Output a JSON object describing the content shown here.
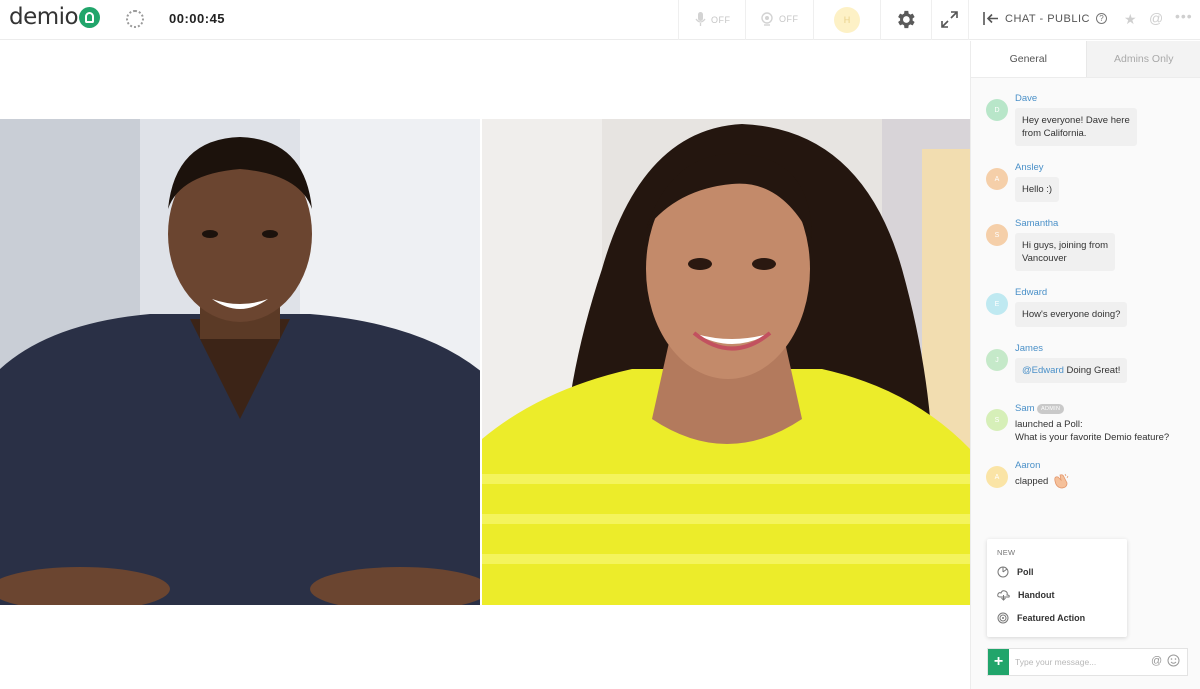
{
  "app": {
    "logo_text": "demio",
    "timer": "00:00:45"
  },
  "toolbar": {
    "mic_label": "OFF",
    "cam_label": "OFF",
    "avatar_initial": "H",
    "chat_title": "CHAT - PUBLIC",
    "help_glyph": "?"
  },
  "chat": {
    "tabs": [
      "General",
      "Admins Only"
    ],
    "messages": [
      {
        "initial": "D",
        "name": "Dave",
        "text1": "Hey everyone! Dave here",
        "text2": "from California.",
        "color": "#b8e6c9"
      },
      {
        "initial": "A",
        "name": "Ansley",
        "text1": "Hello :)",
        "color": "#f5cfa9"
      },
      {
        "initial": "S",
        "name": "Samantha",
        "text1": "Hi guys, joining from",
        "text2": "Vancouver",
        "color": "#f5cfa9"
      },
      {
        "initial": "E",
        "name": "Edward",
        "text1": "How's everyone doing?",
        "color": "#bfe9f1"
      },
      {
        "initial": "J",
        "name": "James",
        "mention": "@Edward",
        "text1": " Doing Great!",
        "color": "#c5e9c9"
      },
      {
        "initial": "S",
        "name": "Sam",
        "badge": "ADMIN",
        "text1": "launched a Poll:",
        "link": "What is your favorite Demio feature?",
        "color": "#d6efb8"
      },
      {
        "initial": "A",
        "name": "Aaron",
        "text1": "clapped",
        "color": "#fae4a6"
      }
    ],
    "new_menu": {
      "label": "NEW",
      "items": [
        "Poll",
        "Handout",
        "Featured Action"
      ]
    },
    "compose": {
      "placeholder": "Type your message...",
      "plus": "+",
      "at": "@"
    }
  },
  "colors": {
    "brand_green": "#21a56b",
    "link_blue": "#4a90c8"
  }
}
